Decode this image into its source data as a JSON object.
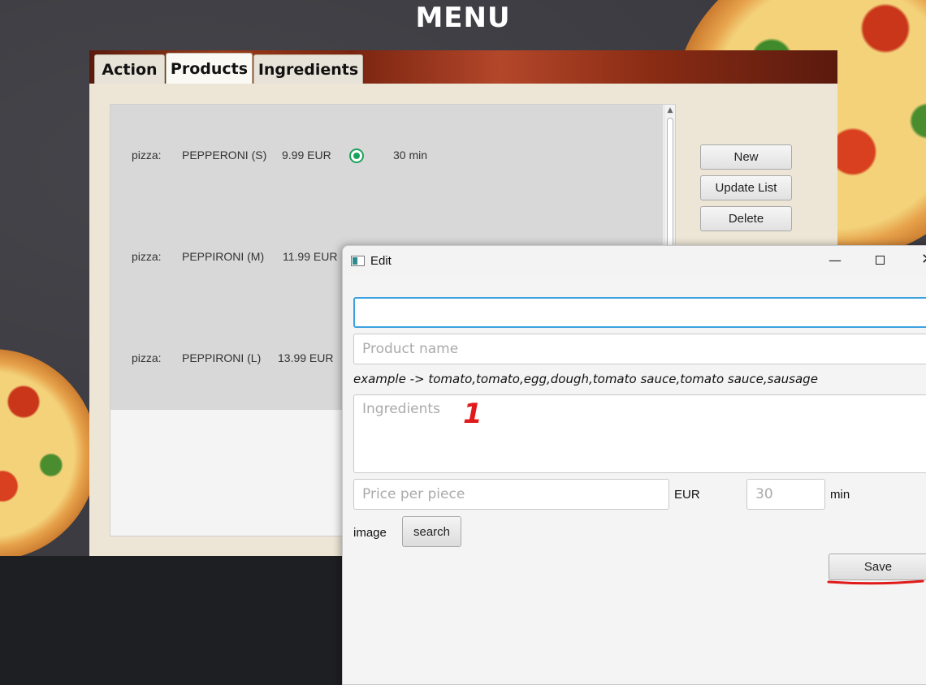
{
  "menu_title": "MENU",
  "tabs": [
    {
      "label": "Action"
    },
    {
      "label": "Products"
    },
    {
      "label": "Ingredients"
    }
  ],
  "products": [
    {
      "type": "pizza:",
      "name": "PEPPERONI (S)",
      "price": "9.99 EUR",
      "time": "30 min",
      "selected": true
    },
    {
      "type": "pizza:",
      "name": "PEPPIRONI (M)",
      "price": "11.99 EUR"
    },
    {
      "type": "pizza:",
      "name": "PEPPIRONI (L)",
      "price": "13.99 EUR"
    }
  ],
  "side_buttons": {
    "new": "New",
    "update": "Update List",
    "delete": "Delete"
  },
  "dialog": {
    "title": "Edit",
    "id_value": "",
    "name_placeholder": "Product name",
    "example": "example -> tomato,tomato,egg,dough,tomato sauce,tomato sauce,sausage",
    "ingredients_placeholder": "Ingredients",
    "price_placeholder": "Price per piece",
    "eur_label": "EUR",
    "time_placeholder": "30",
    "min_label": "min",
    "image_label": "image",
    "search_label": "search",
    "save_label": "Save"
  },
  "annotation": {
    "number": "1",
    "color": "#e01a1a"
  },
  "colors": {
    "accent_focus": "#3ba1e0",
    "radio_green": "#1aa35b"
  }
}
